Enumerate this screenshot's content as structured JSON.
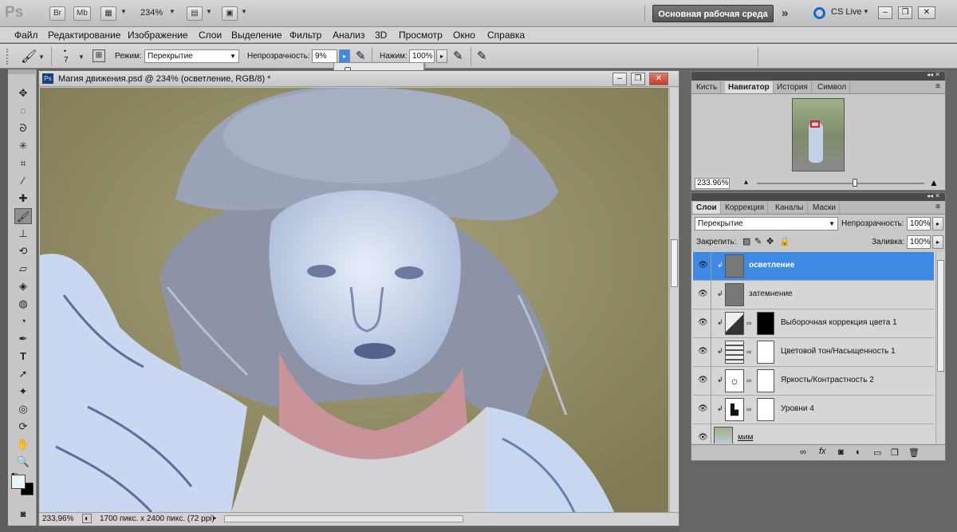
{
  "appbar": {
    "logo": "Ps",
    "bridge": "Br",
    "minibridge": "Mb",
    "zoom": "234%",
    "workspace": "Основная рабочая среда",
    "cs_live": "CS Live"
  },
  "menu": [
    "Файл",
    "Редактирование",
    "Изображение",
    "Слои",
    "Выделение",
    "Фильтр",
    "Анализ",
    "3D",
    "Просмотр",
    "Окно",
    "Справка"
  ],
  "options": {
    "brush_size": "7",
    "mode_label": "Режим:",
    "mode_value": "Перекрытие",
    "opacity_label": "Непрозрачность:",
    "opacity_value": "9%",
    "pressure_label": "Нажим:",
    "pressure_value": "100%",
    "opacity_slider_level": 0.09
  },
  "document": {
    "title": "Магия движения.psd @ 234% (осветление, RGB/8) *",
    "zoom": "233,96%",
    "info": "1700 пикс. x 2400 пикс. (72 ppi)"
  },
  "navigator": {
    "tabs": [
      "Кисть",
      "Навигатор",
      "История",
      "Символ"
    ],
    "active_tab": "Навигатор",
    "zoom": "233.96%"
  },
  "layers": {
    "tabs": [
      "Слои",
      "Коррекция",
      "Каналы",
      "Маски"
    ],
    "active_tab": "Слои",
    "blend_mode": "Перекрытие",
    "opacity_label": "Непрозрачность:",
    "opacity_value": "100%",
    "lock_label": "Закрепить:",
    "fill_label": "Заливка:",
    "fill_value": "100%",
    "items": [
      {
        "name": "осветление"
      },
      {
        "name": "затемнение"
      },
      {
        "name": "Выборочная коррекция цвета 1"
      },
      {
        "name": "Цветовой тон/Насыщенность 1"
      },
      {
        "name": "Яркость/Контрастность 2"
      },
      {
        "name": "Уровни 4"
      },
      {
        "name": "мим"
      }
    ]
  },
  "colors": {
    "selection": "#3d89e3",
    "workspace_btn": "#555555"
  }
}
